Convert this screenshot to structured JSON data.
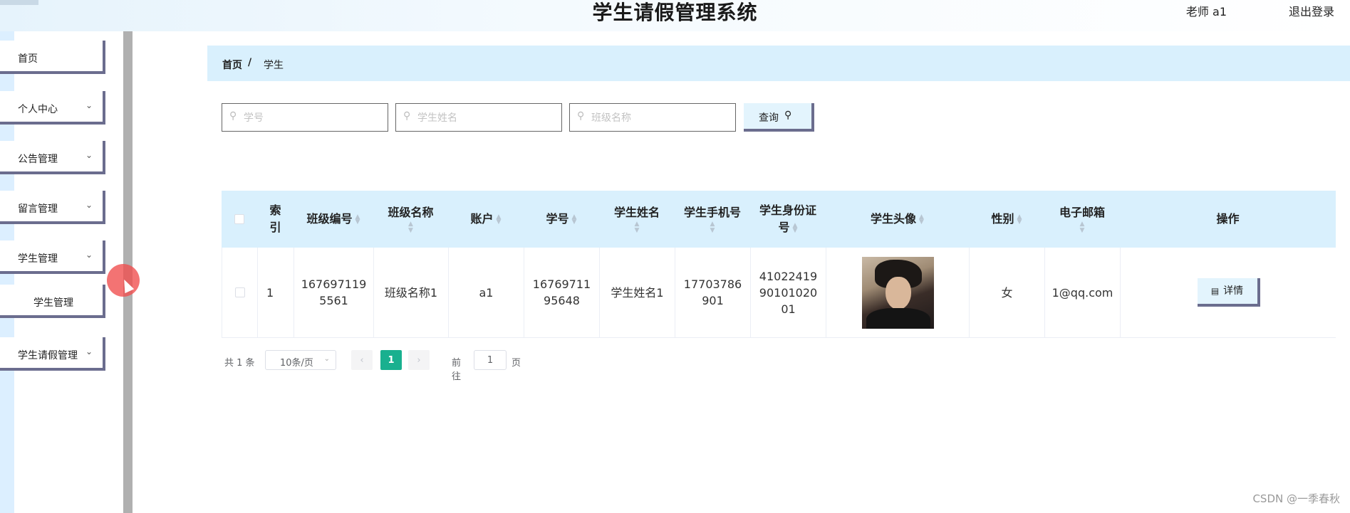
{
  "header": {
    "title": "学生请假管理系统",
    "user": "老师 a1",
    "logout": "退出登录"
  },
  "sidebar": {
    "items": [
      {
        "label": "首页"
      },
      {
        "label": "个人中心"
      },
      {
        "label": "公告管理"
      },
      {
        "label": "留言管理"
      },
      {
        "label": "学生管理"
      },
      {
        "label": "学生管理"
      },
      {
        "label": "学生请假管理"
      }
    ]
  },
  "breadcrumb": {
    "home": "首页",
    "separator": "/",
    "current": "学生"
  },
  "search": {
    "student_no_placeholder": "学号",
    "student_name_placeholder": "学生姓名",
    "class_name_placeholder": "班级名称",
    "query_label": "查询"
  },
  "table": {
    "headers": {
      "index_1": "索",
      "index_2": "引",
      "class_no": "班级编号",
      "class_name": "班级名称",
      "account": "账户",
      "student_no": "学号",
      "student_name": "学生姓名",
      "phone": "学生手机号",
      "id_card_1": "学生身份证",
      "id_card_2": "号",
      "avatar": "学生头像",
      "gender": "性别",
      "email": "电子邮箱",
      "actions": "操作"
    },
    "rows": [
      {
        "index": "1",
        "class_no_1": "167697119",
        "class_no_2": "5561",
        "class_name": "班级名称1",
        "account": "a1",
        "student_no_1": "16769711",
        "student_no_2": "95648",
        "student_name": "学生姓名1",
        "phone_1": "17703786",
        "phone_2": "901",
        "id_card_1": "41022419",
        "id_card_2": "90101020",
        "id_card_3": "01",
        "gender": "女",
        "email": "1@qq.com",
        "detail_label": "详情"
      }
    ]
  },
  "pagination": {
    "total": "共 1 条",
    "page_size": "10条/页",
    "current_page": "1",
    "goto_label": "前往",
    "goto_value": "1",
    "page_unit": "页"
  },
  "watermark": "CSDN @一季春秋",
  "colors": {
    "accent": "#19b08f",
    "header_bg": "#d9f0fd",
    "button_border": "#6b6d8e"
  }
}
